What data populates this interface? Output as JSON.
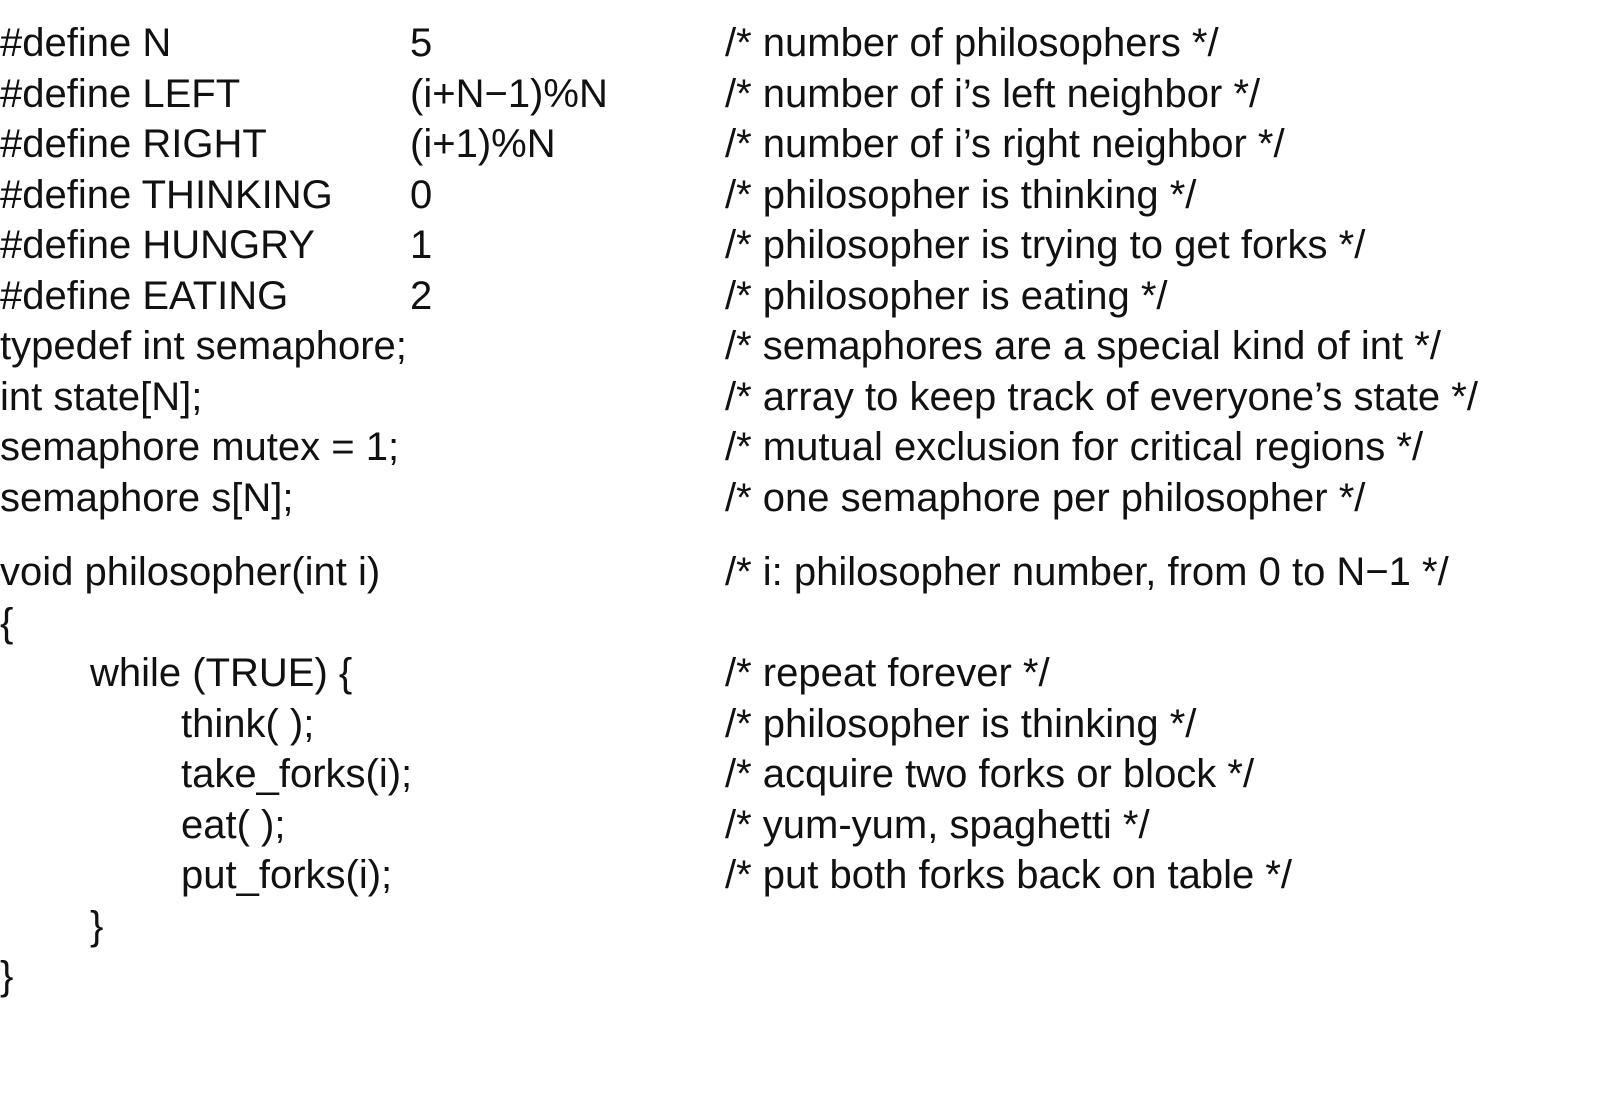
{
  "listing": {
    "defines": [
      {
        "code": "#define N",
        "value": "5",
        "comment": "/* number of philosophers */"
      },
      {
        "code": "#define LEFT",
        "value": "(i+N−1)%N",
        "comment": "/* number of i’s left neighbor */"
      },
      {
        "code": "#define RIGHT",
        "value": "(i+1)%N",
        "comment": "/* number of i’s right neighbor */"
      },
      {
        "code": "#define THINKING",
        "value": "0",
        "comment": "/* philosopher is thinking */"
      },
      {
        "code": "#define HUNGRY",
        "value": "1",
        "comment": "/* philosopher is trying to get forks */"
      },
      {
        "code": "#define EATING",
        "value": "2",
        "comment": "/* philosopher is eating */"
      }
    ],
    "declarations": [
      {
        "code": "typedef int semaphore;",
        "comment": "/* semaphores are a special kind of int */"
      },
      {
        "code": "int state[N];",
        "comment": "/* array to keep track of everyone’s state */"
      },
      {
        "code": "semaphore mutex = 1;",
        "comment": "/* mutual exclusion for critical regions */"
      },
      {
        "code": "semaphore s[N];",
        "comment": "/* one semaphore per philosopher */"
      }
    ],
    "function": {
      "signature": {
        "code": "void philosopher(int i)",
        "comment": "/* i: philosopher number, from 0 to N−1 */"
      },
      "open_brace": "{",
      "loop": {
        "code": "while (TRUE) {",
        "comment": "/* repeat forever */"
      },
      "body": [
        {
          "code": "think( );",
          "comment": "/* philosopher is thinking */"
        },
        {
          "code": "take_forks(i);",
          "comment": "/* acquire two forks or block */"
        },
        {
          "code": "eat( );",
          "comment": "/* yum-yum, spaghetti */"
        },
        {
          "code": "put_forks(i);",
          "comment": "/* put both forks back on table */"
        }
      ],
      "loop_close": "}",
      "close_brace": "}"
    }
  }
}
